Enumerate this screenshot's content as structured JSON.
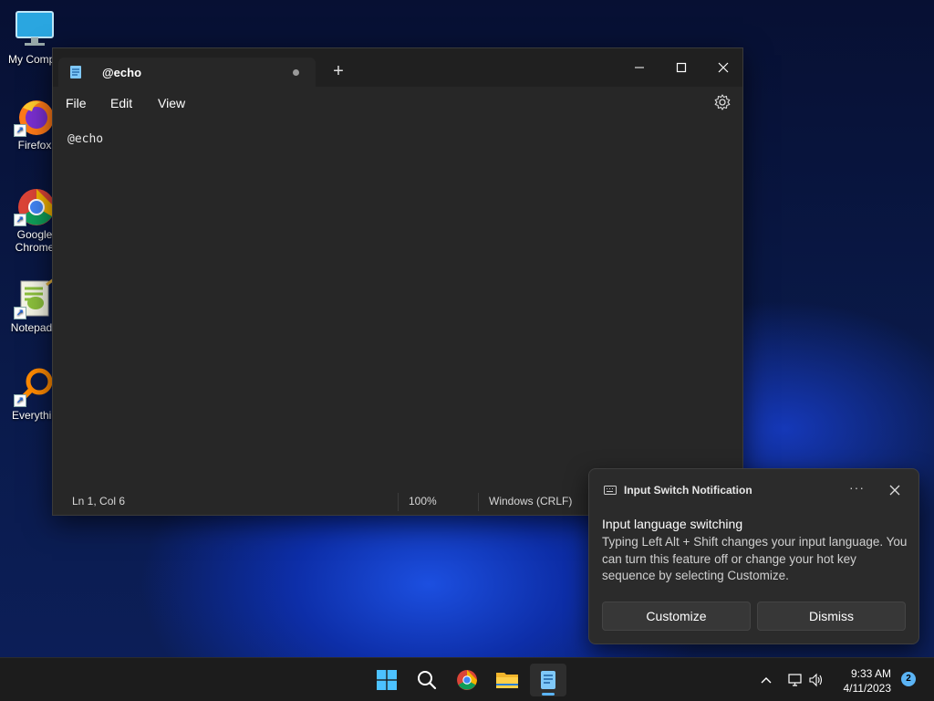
{
  "desktop": {
    "icons": [
      {
        "label": "My Compu",
        "icon": "monitor-icon"
      },
      {
        "label": "Firefox",
        "icon": "firefox-icon"
      },
      {
        "label_line1": "Google",
        "label_line2": "Chrome",
        "icon": "chrome-icon"
      },
      {
        "label": "Notepad+",
        "icon": "notepadpp-icon"
      },
      {
        "label": "Everythin",
        "icon": "everything-icon"
      }
    ]
  },
  "notepad": {
    "tab_title": "@echo",
    "new_tab_label": "+",
    "menu": [
      "File",
      "Edit",
      "View"
    ],
    "content": "@echo",
    "status": {
      "position": "Ln 1, Col 6",
      "zoom": "100%",
      "line_ending": "Windows (CRLF)"
    }
  },
  "notification": {
    "app_name": "Input Switch Notification",
    "more_label": "···",
    "title": "Input language switching",
    "body": "Typing Left Alt + Shift changes your input language. You can turn this feature off or change your hot key sequence by selecting Customize.",
    "buttons": {
      "customize": "Customize",
      "dismiss": "Dismiss"
    }
  },
  "taskbar": {
    "apps": [
      "start-icon",
      "search-icon",
      "chrome-icon",
      "file-explorer-icon",
      "notepad-icon"
    ],
    "active_app": "notepad-icon",
    "tray": {
      "time": "9:33 AM",
      "date": "4/11/2023",
      "notification_count": "2"
    }
  },
  "colors": {
    "accent": "#5bb4f5",
    "window_bg": "#272727",
    "titlebar_bg": "#202020",
    "taskbar_bg": "#1c1c1c"
  }
}
